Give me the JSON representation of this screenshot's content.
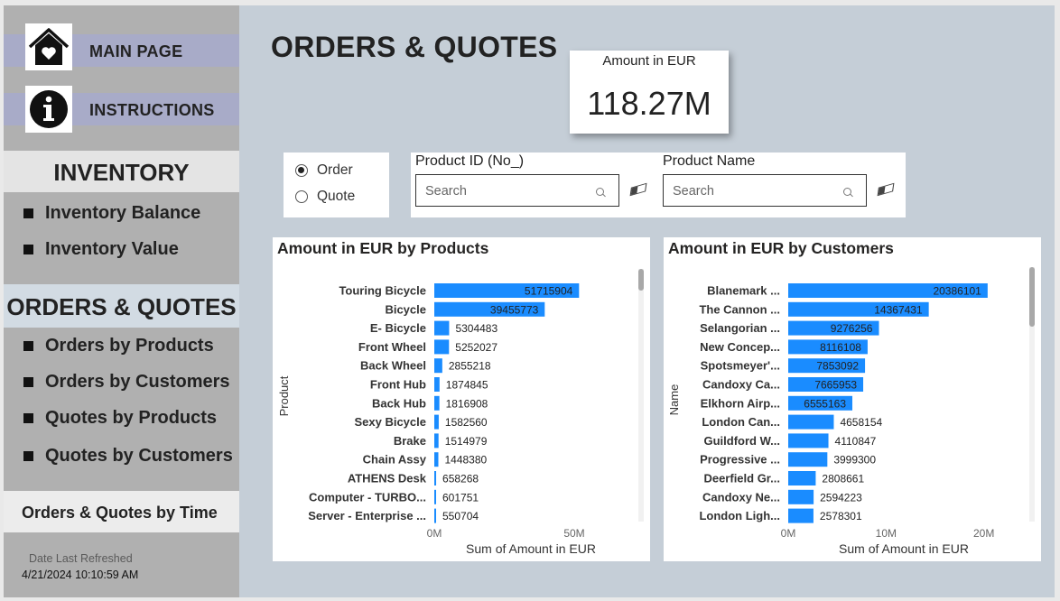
{
  "sidebar": {
    "main_page": "MAIN PAGE",
    "instructions": "INSTRUCTIONS",
    "inventory_header": "INVENTORY",
    "inventory_items": [
      "Inventory Balance",
      "Inventory Value"
    ],
    "orders_header": "ORDERS & QUOTES",
    "orders_items": [
      "Orders by Products",
      "Orders by Customers",
      "Quotes by Products",
      "Quotes by Customers"
    ],
    "time_button": "Orders & Quotes by Time",
    "refresh_caption": "Date Last Refreshed",
    "refresh_value": "4/21/2024 10:10:59 AM",
    "icons": {
      "home": "house-heart-icon",
      "info": "info-icon"
    }
  },
  "page": {
    "title": "ORDERS & QUOTES"
  },
  "kpi": {
    "caption": "Amount in EUR",
    "value": "118.27M"
  },
  "radio": {
    "options": [
      "Order",
      "Quote"
    ],
    "selected": "Order"
  },
  "slicers": [
    {
      "title": "Product ID (No_)",
      "placeholder": "Search"
    },
    {
      "title": "Product Name",
      "placeholder": "Search"
    }
  ],
  "colors": {
    "bar": "#1a8cff",
    "canvas": "#c5ced7",
    "sidebar": "#b0b0b0",
    "nav_button": "#a8abc8"
  },
  "chart_data": [
    {
      "type": "bar",
      "orientation": "horizontal",
      "title": "Amount in EUR by Products",
      "xlabel": "Sum of Amount in EUR",
      "ylabel": "Product",
      "xlim": [
        0,
        60000000
      ],
      "xticks": [
        0,
        50000000
      ],
      "xtick_labels": [
        "0M",
        "50M"
      ],
      "categories": [
        "Touring Bicycle",
        "Bicycle",
        "E- Bicycle",
        "Front Wheel",
        "Back Wheel",
        "Front Hub",
        "Back Hub",
        "Sexy Bicycle",
        "Brake",
        "Chain Assy",
        "ATHENS Desk",
        "Computer - TURBO...",
        "Server - Enterprise ..."
      ],
      "values": [
        51715904,
        39455773,
        5304483,
        5252027,
        2855218,
        1874845,
        1816908,
        1582560,
        1514979,
        1448380,
        658268,
        601751,
        550704
      ],
      "labels": [
        "51715904",
        "39455773",
        "5304483",
        "5252027",
        "2855218",
        "1874845",
        "1816908",
        "1582560",
        "1514979",
        "1448380",
        "658268",
        "601751",
        "550704"
      ]
    },
    {
      "type": "bar",
      "orientation": "horizontal",
      "title": "Amount in EUR by Customers",
      "xlabel": "Sum of Amount in EUR",
      "ylabel": "Name",
      "xlim": [
        0,
        24000000
      ],
      "xticks": [
        0,
        10000000,
        20000000
      ],
      "xtick_labels": [
        "0M",
        "10M",
        "20M"
      ],
      "categories": [
        "Blanemark ...",
        "The Cannon ...",
        "Selangorian ...",
        "New Concep...",
        "Spotsmeyer'...",
        "Candoxy Ca...",
        "Elkhorn Airp...",
        "London Can...",
        "Guildford W...",
        "Progressive ...",
        "Deerfield Gr...",
        "Candoxy Ne...",
        "London Ligh..."
      ],
      "values": [
        20386101,
        14367431,
        9276256,
        8116108,
        7853092,
        7665953,
        6555163,
        4658154,
        4110847,
        3999300,
        2808661,
        2594223,
        2578301
      ],
      "labels": [
        "20386101",
        "14367431",
        "9276256",
        "8116108",
        "7853092",
        "7665953",
        "6555163",
        "4658154",
        "4110847",
        "3999300",
        "2808661",
        "2594223",
        "2578301"
      ]
    }
  ]
}
